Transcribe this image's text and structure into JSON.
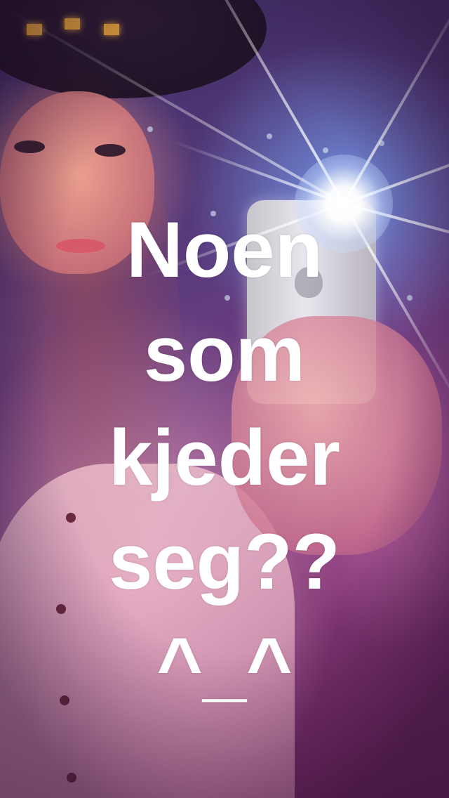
{
  "caption": {
    "text": "Noen\nsom\nkjeder\nseg??\n^_^",
    "color": "#ffffff"
  }
}
